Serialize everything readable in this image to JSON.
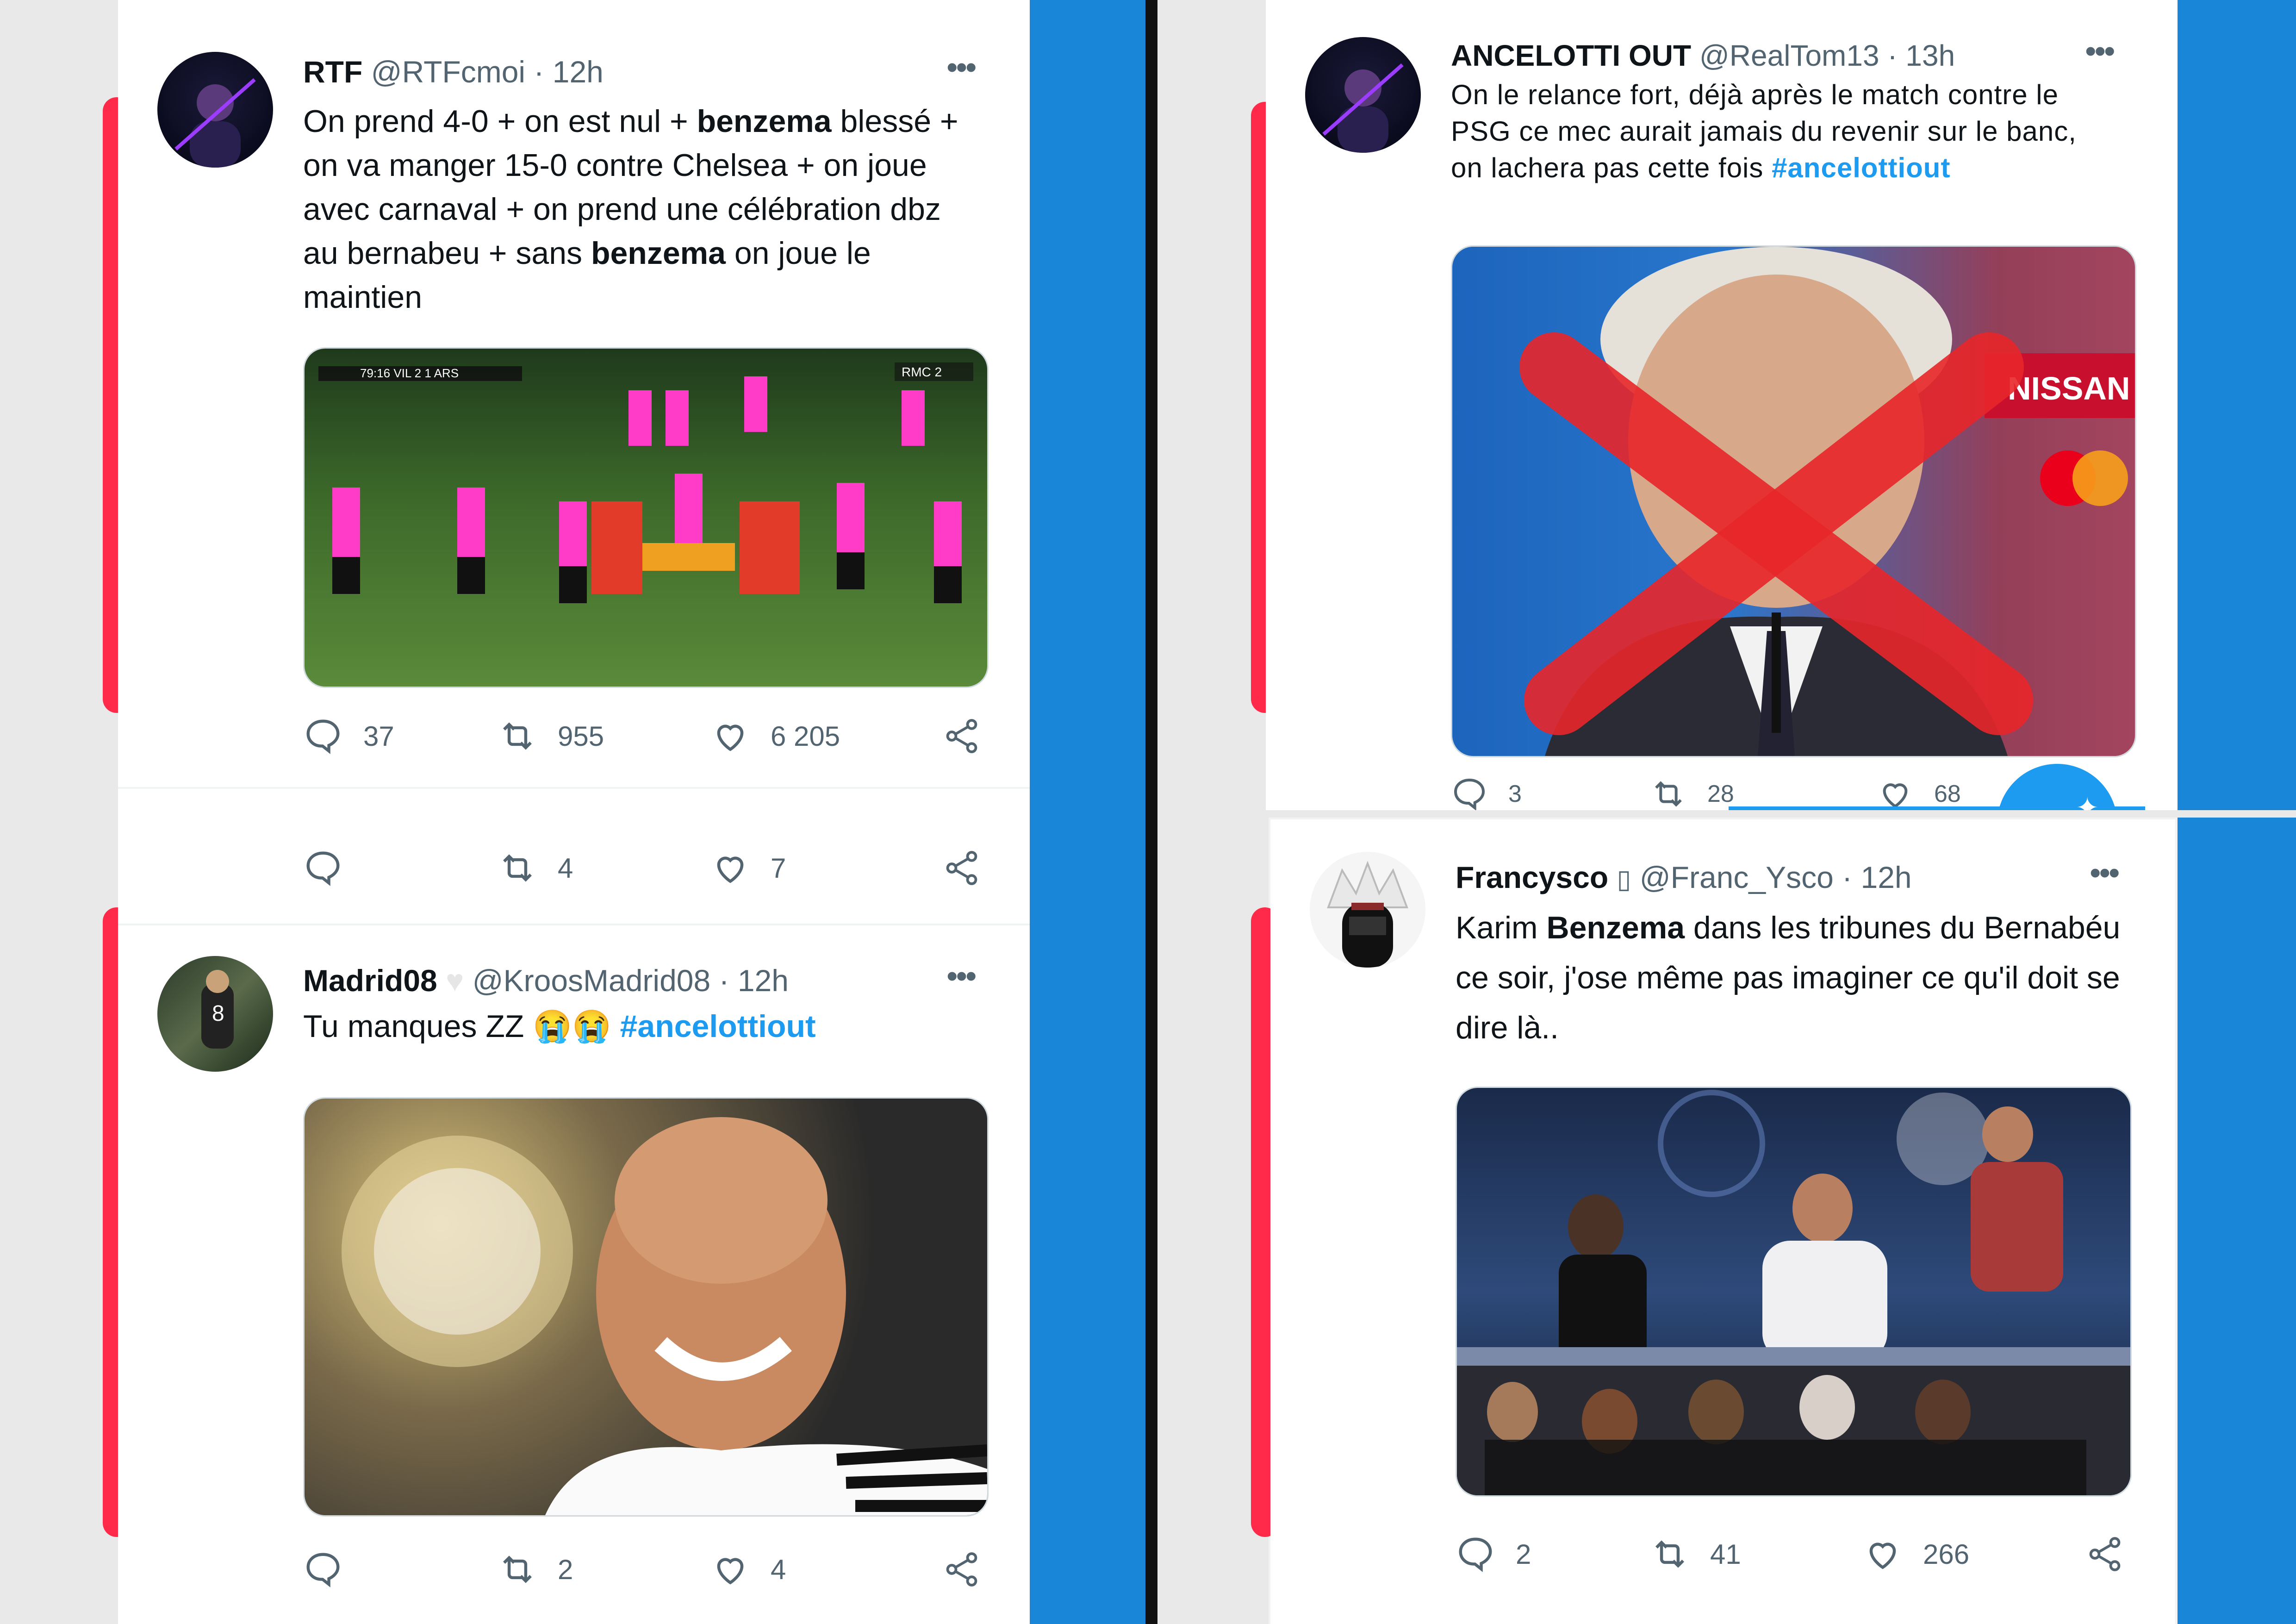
{
  "tweets": [
    {
      "name": "RTF",
      "handle": "@RTFcmoi",
      "time": "· 12h",
      "text_html": "On prend 4-0 + on est nul + <b>benzema</b> blessé + on va manger 15-0 contre Chelsea + on joue avec carnaval + on prend une célébration dbz au bernabeu + sans <b>benzema</b> on joue le maintien",
      "media": {
        "scoreboard_time": "79:16",
        "home": "VIL",
        "score_home": "2",
        "score_away": "1",
        "away": "ARS",
        "broadcaster": "RMC 2"
      },
      "replies": "37",
      "retweets": "955",
      "likes": "6 205"
    },
    {
      "name": "ANCELOTTI OUT",
      "handle": "@RealTom13",
      "time": "· 13h",
      "text_html": "On le relance fort, déjà après le match contre le PSG ce mec aurait jamais du revenir sur le banc, on lachera pas cette fois <span class=\"hashtag\">#ancelottiout</span>",
      "media": {
        "brand1": "NISSAN"
      },
      "replies": "3",
      "retweets": "28",
      "likes": "68"
    },
    {
      "name": "Madrid08",
      "handle": "@KroosMadrid08",
      "time": "· 12h",
      "text_html": "Tu manques ZZ 😭😭 <span class=\"hashtag\">#ancelottiout</span>",
      "replies": "",
      "retweets": "2",
      "likes": "4"
    },
    {
      "name": "Francysco",
      "handle": "@Franc_Ysco",
      "time": "· 12h",
      "text_html": "Karim <b>Benzema</b> dans les tribunes du Bernabéu ce soir, j'ose même pas imaginer ce qu'il doit se dire là..",
      "replies": "2",
      "retweets": "41",
      "likes": "266"
    }
  ],
  "partial_actions": {
    "replies": "",
    "retweets": "4",
    "likes": "7"
  },
  "colors": {
    "accent": "#1d9bf0",
    "meta": "#536471",
    "background_blue": "#1a86d8",
    "strip_red": "#ff2a4a"
  }
}
